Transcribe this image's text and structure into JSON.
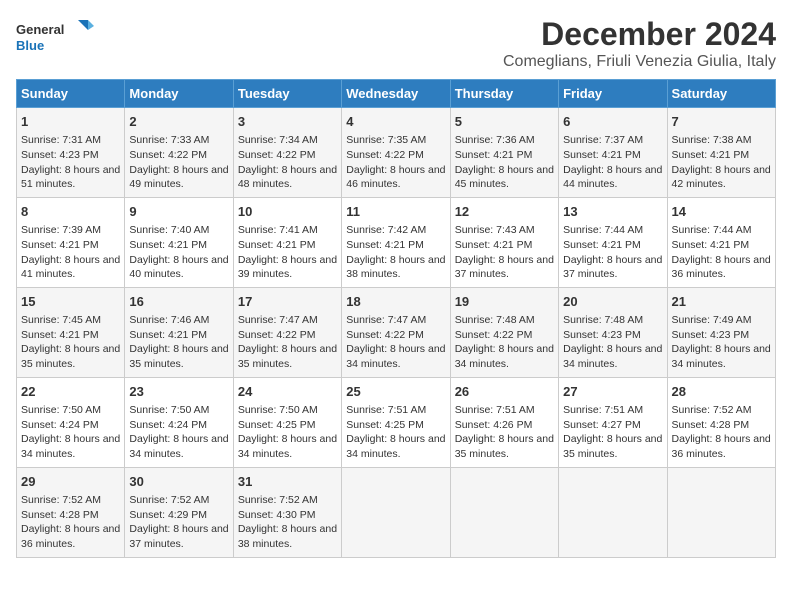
{
  "logo": {
    "line1": "General",
    "line2": "Blue"
  },
  "title": "December 2024",
  "subtitle": "Comeglians, Friuli Venezia Giulia, Italy",
  "days_header": [
    "Sunday",
    "Monday",
    "Tuesday",
    "Wednesday",
    "Thursday",
    "Friday",
    "Saturday"
  ],
  "weeks": [
    [
      {
        "day": "1",
        "sunrise": "7:31 AM",
        "sunset": "4:23 PM",
        "daylight": "8 hours and 51 minutes."
      },
      {
        "day": "2",
        "sunrise": "7:33 AM",
        "sunset": "4:22 PM",
        "daylight": "8 hours and 49 minutes."
      },
      {
        "day": "3",
        "sunrise": "7:34 AM",
        "sunset": "4:22 PM",
        "daylight": "8 hours and 48 minutes."
      },
      {
        "day": "4",
        "sunrise": "7:35 AM",
        "sunset": "4:22 PM",
        "daylight": "8 hours and 46 minutes."
      },
      {
        "day": "5",
        "sunrise": "7:36 AM",
        "sunset": "4:21 PM",
        "daylight": "8 hours and 45 minutes."
      },
      {
        "day": "6",
        "sunrise": "7:37 AM",
        "sunset": "4:21 PM",
        "daylight": "8 hours and 44 minutes."
      },
      {
        "day": "7",
        "sunrise": "7:38 AM",
        "sunset": "4:21 PM",
        "daylight": "8 hours and 42 minutes."
      }
    ],
    [
      {
        "day": "8",
        "sunrise": "7:39 AM",
        "sunset": "4:21 PM",
        "daylight": "8 hours and 41 minutes."
      },
      {
        "day": "9",
        "sunrise": "7:40 AM",
        "sunset": "4:21 PM",
        "daylight": "8 hours and 40 minutes."
      },
      {
        "day": "10",
        "sunrise": "7:41 AM",
        "sunset": "4:21 PM",
        "daylight": "8 hours and 39 minutes."
      },
      {
        "day": "11",
        "sunrise": "7:42 AM",
        "sunset": "4:21 PM",
        "daylight": "8 hours and 38 minutes."
      },
      {
        "day": "12",
        "sunrise": "7:43 AM",
        "sunset": "4:21 PM",
        "daylight": "8 hours and 37 minutes."
      },
      {
        "day": "13",
        "sunrise": "7:44 AM",
        "sunset": "4:21 PM",
        "daylight": "8 hours and 37 minutes."
      },
      {
        "day": "14",
        "sunrise": "7:44 AM",
        "sunset": "4:21 PM",
        "daylight": "8 hours and 36 minutes."
      }
    ],
    [
      {
        "day": "15",
        "sunrise": "7:45 AM",
        "sunset": "4:21 PM",
        "daylight": "8 hours and 35 minutes."
      },
      {
        "day": "16",
        "sunrise": "7:46 AM",
        "sunset": "4:21 PM",
        "daylight": "8 hours and 35 minutes."
      },
      {
        "day": "17",
        "sunrise": "7:47 AM",
        "sunset": "4:22 PM",
        "daylight": "8 hours and 35 minutes."
      },
      {
        "day": "18",
        "sunrise": "7:47 AM",
        "sunset": "4:22 PM",
        "daylight": "8 hours and 34 minutes."
      },
      {
        "day": "19",
        "sunrise": "7:48 AM",
        "sunset": "4:22 PM",
        "daylight": "8 hours and 34 minutes."
      },
      {
        "day": "20",
        "sunrise": "7:48 AM",
        "sunset": "4:23 PM",
        "daylight": "8 hours and 34 minutes."
      },
      {
        "day": "21",
        "sunrise": "7:49 AM",
        "sunset": "4:23 PM",
        "daylight": "8 hours and 34 minutes."
      }
    ],
    [
      {
        "day": "22",
        "sunrise": "7:50 AM",
        "sunset": "4:24 PM",
        "daylight": "8 hours and 34 minutes."
      },
      {
        "day": "23",
        "sunrise": "7:50 AM",
        "sunset": "4:24 PM",
        "daylight": "8 hours and 34 minutes."
      },
      {
        "day": "24",
        "sunrise": "7:50 AM",
        "sunset": "4:25 PM",
        "daylight": "8 hours and 34 minutes."
      },
      {
        "day": "25",
        "sunrise": "7:51 AM",
        "sunset": "4:25 PM",
        "daylight": "8 hours and 34 minutes."
      },
      {
        "day": "26",
        "sunrise": "7:51 AM",
        "sunset": "4:26 PM",
        "daylight": "8 hours and 35 minutes."
      },
      {
        "day": "27",
        "sunrise": "7:51 AM",
        "sunset": "4:27 PM",
        "daylight": "8 hours and 35 minutes."
      },
      {
        "day": "28",
        "sunrise": "7:52 AM",
        "sunset": "4:28 PM",
        "daylight": "8 hours and 36 minutes."
      }
    ],
    [
      {
        "day": "29",
        "sunrise": "7:52 AM",
        "sunset": "4:28 PM",
        "daylight": "8 hours and 36 minutes."
      },
      {
        "day": "30",
        "sunrise": "7:52 AM",
        "sunset": "4:29 PM",
        "daylight": "8 hours and 37 minutes."
      },
      {
        "day": "31",
        "sunrise": "7:52 AM",
        "sunset": "4:30 PM",
        "daylight": "8 hours and 38 minutes."
      },
      null,
      null,
      null,
      null
    ]
  ]
}
